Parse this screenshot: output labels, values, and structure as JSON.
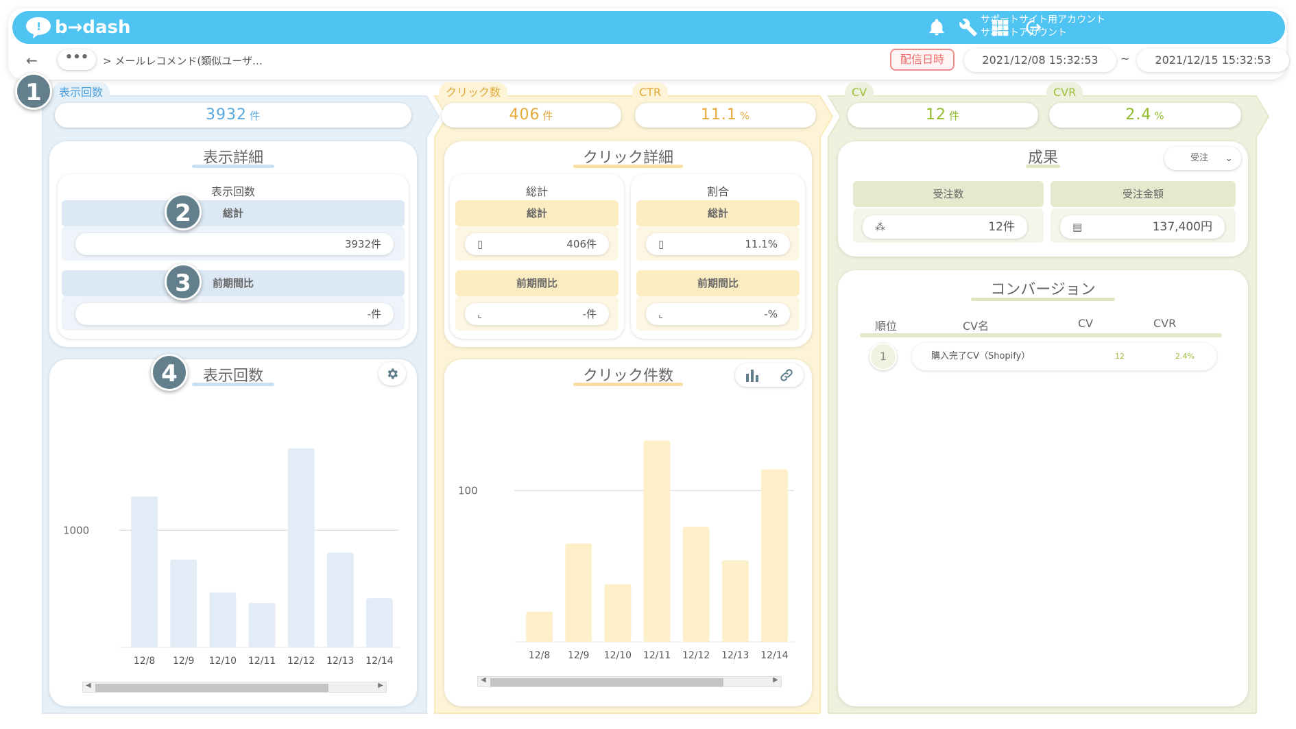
{
  "header": {
    "logo": "b→dash",
    "account_line1": "サポートサイト用アカウント",
    "account_line2": "サポートアカウント",
    "icons": [
      "bell-icon",
      "wrench-icon",
      "grid-icon",
      "logout-icon"
    ]
  },
  "subbar": {
    "back": "←",
    "more": "•••",
    "breadcrumb": "> メールレコメンド(類似ユーザ…",
    "date_label": "配信日時",
    "date_from": "2021/12/08 15:32:53",
    "tilde": "~",
    "date_to": "2021/12/15 15:32:53"
  },
  "badges": [
    "1",
    "2",
    "3",
    "4"
  ],
  "impressions": {
    "tag": "表示回数",
    "value": "3932",
    "unit": "件",
    "detail_title": "表示詳細",
    "sub_title": "表示回数",
    "total_label": "総計",
    "total_value": "3932件",
    "prev_label": "前期間比",
    "prev_value": "-件",
    "chart_title": "表示回数",
    "color": "#e3eff8"
  },
  "clicks": {
    "tag_clicks": "クリック数",
    "value_clicks": "406",
    "unit_clicks": "件",
    "tag_ctr": "CTR",
    "value_ctr": "11.1",
    "unit_ctr": "%",
    "detail_title": "クリック詳細",
    "total_sub": "総計",
    "ratio_sub": "割合",
    "total_label": "総計",
    "total_value": "406件",
    "prev_label": "前期間比",
    "prev_value": "-件",
    "ratio_total_label": "総計",
    "ratio_total_value": "11.1%",
    "ratio_prev_label": "前期間比",
    "ratio_prev_value": "-%",
    "chart_title": "クリック件数",
    "color": "#fdf1cf"
  },
  "conversions": {
    "tag_cv": "CV",
    "value_cv": "12",
    "unit_cv": "件",
    "tag_cvr": "CVR",
    "value_cvr": "2.4",
    "unit_cvr": "%",
    "results_title": "成果",
    "select_value": "受注",
    "orders_label": "受注数",
    "orders_value": "12件",
    "amount_label": "受注金額",
    "amount_value": "137,400円",
    "conv_title": "コンバージョン",
    "columns": [
      "順位",
      "CV名",
      "CV",
      "CVR"
    ],
    "rows": [
      {
        "rank": "1",
        "name": "購入完了CV（Shopify）",
        "cv": "12",
        "cvr": "2.4%"
      }
    ],
    "color": "#eaefd6"
  },
  "chart_data": [
    {
      "type": "bar",
      "title": "表示回数",
      "categories": [
        "12/8",
        "12/9",
        "12/10",
        "12/11",
        "12/12",
        "12/13",
        "12/14"
      ],
      "values": [
        1290,
        750,
        470,
        380,
        1700,
        810,
        420
      ],
      "ytick_label": "1000",
      "ylim": [
        0,
        2050
      ],
      "grid": true,
      "color": "#e1ecf6"
    },
    {
      "type": "bar",
      "title": "クリック件数",
      "categories": [
        "12/8",
        "12/9",
        "12/10",
        "12/11",
        "12/12",
        "12/13",
        "12/14"
      ],
      "values": [
        20,
        65,
        38,
        133,
        76,
        54,
        114
      ],
      "ytick_label": "100",
      "ylim": [
        0,
        155
      ],
      "grid": true,
      "color": "#fdf0c9"
    }
  ]
}
